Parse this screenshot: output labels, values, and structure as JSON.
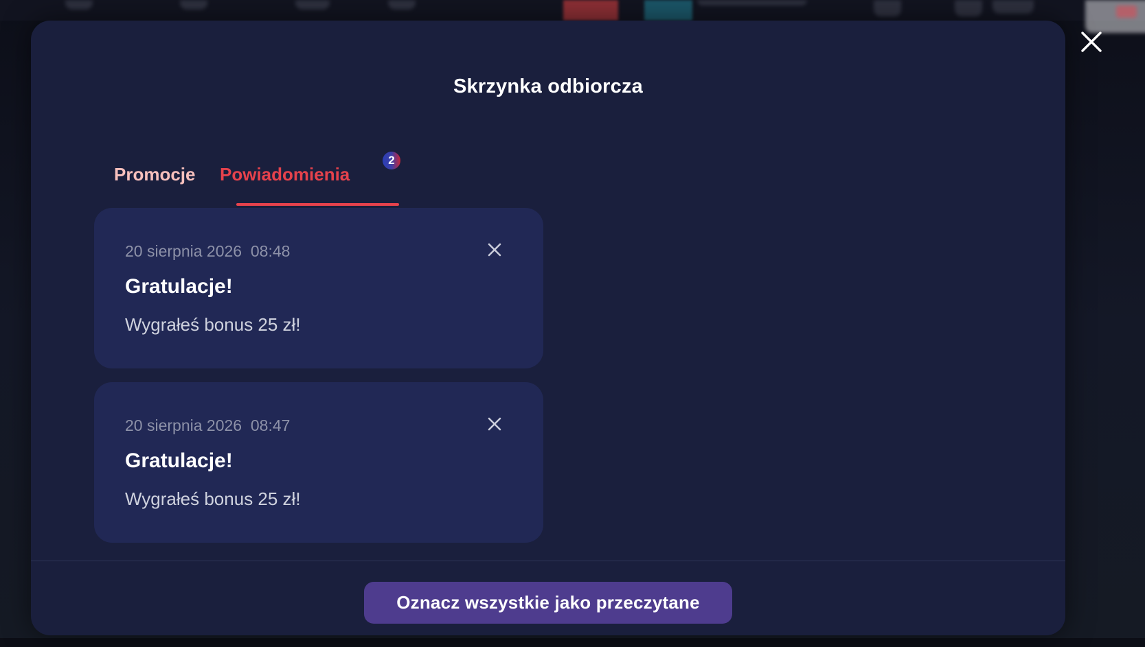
{
  "modal": {
    "title": "Skrzynka odbiorcza",
    "tabs": [
      {
        "label": "Promocje",
        "active": false
      },
      {
        "label": "Powiadomienia",
        "active": true,
        "badge": "2"
      }
    ],
    "notifications": [
      {
        "date": "20 sierpnia 2026",
        "time": "08:48",
        "title": "Gratulacje!",
        "body": "Wygrałeś bonus 25 zł!"
      },
      {
        "date": "20 sierpnia 2026",
        "time": "08:47",
        "title": "Gratulacje!",
        "body": "Wygrałeś bonus 25 zł!"
      }
    ],
    "mark_all_label": "Oznacz wszystkie jako przeczytane"
  },
  "icons": {
    "modal_close": "close-icon",
    "notification_close": "close-icon"
  },
  "colors": {
    "modal_background": "#1a1f3d",
    "card_background": "#212855",
    "active_tab": "#e6424c",
    "inactive_tab": "#f7c0bd",
    "primary_button": "#4e3c8e"
  }
}
